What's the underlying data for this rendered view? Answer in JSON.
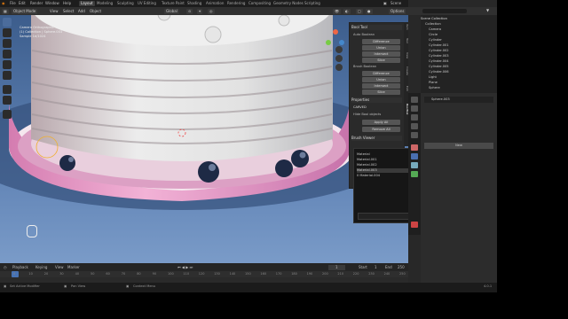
{
  "menu": [
    "File",
    "Edit",
    "Render",
    "Window",
    "Help"
  ],
  "workspaces": [
    "Layout",
    "Modeling",
    "Sculpting",
    "UV Editing",
    "Texture Paint",
    "Shading",
    "Animation",
    "Rendering",
    "Compositing",
    "Geometry Nodes",
    "Scripting"
  ],
  "active_workspace": "Layout",
  "scene": {
    "scene_name": "Scene",
    "view_layer": "ViewLayer"
  },
  "viewport_header": {
    "mode": "Object Mode",
    "menus": [
      "View",
      "Select",
      "Add",
      "Object"
    ],
    "orientation": "Global",
    "options": "Options"
  },
  "overlay_text": [
    "Camera Orthographic",
    "(1) Collection | Sphere.003",
    "Sample 1e/1024"
  ],
  "bool_tool": {
    "title": "Bool Tool",
    "auto_boolean_label": "Auto Boolean",
    "auto_buttons": [
      "Difference",
      "Union",
      "Intersect",
      "Slice"
    ],
    "brush_boolean_label": "Brush Boolean",
    "brush_buttons": [
      "Difference",
      "Union",
      "Intersect",
      "Slice"
    ],
    "properties_title": "Properties",
    "cutters_label": "CARVED",
    "hide_label": "Hide Bool objects",
    "apply_all": "Apply All",
    "remove_all": "Remove All",
    "brush_viewer": "Brush Viewer"
  },
  "sidebar_tabs": [
    "Item",
    "Tool",
    "View",
    "Create",
    "Edit",
    "BoolTool"
  ],
  "material_popup": {
    "items": [
      "Material",
      "Material.001",
      "Material.002",
      "Material.003",
      "0 Material.004"
    ],
    "selected_index": 3
  },
  "outliner": {
    "title": "Scene Collection",
    "rows": [
      "Collection",
      "Camera",
      "Circle",
      "Cylinder",
      "Cylinder.001",
      "Cylinder.002",
      "Cylinder.003",
      "Cylinder.004",
      "Cylinder.005",
      "Cylinder.006",
      "Light",
      "Plane",
      "Sphere"
    ]
  },
  "properties": {
    "object_name": "Sphere.003",
    "new_button": "New"
  },
  "timeline": {
    "menus": [
      "Playback",
      "Keying",
      "View",
      "Marker"
    ],
    "current_frame": "1",
    "start_label": "Start",
    "start": "1",
    "end_label": "End",
    "end": "250",
    "ticks": [
      "0",
      "10",
      "20",
      "30",
      "40",
      "50",
      "60",
      "70",
      "80",
      "90",
      "100",
      "110",
      "120",
      "130",
      "140",
      "150",
      "160",
      "170",
      "180",
      "190",
      "200",
      "210",
      "220",
      "230",
      "240",
      "250"
    ]
  },
  "status_bar": {
    "left": "Set Active Modifier",
    "mid1": "Pan View",
    "mid2": "Context Menu",
    "version": "4.0.1"
  },
  "colors": {
    "accent": "#4772b3",
    "cake": "#dcdcdc",
    "plate": "#e8a2c8",
    "floor": "#5f82b4",
    "berry": "#1e2a45"
  }
}
